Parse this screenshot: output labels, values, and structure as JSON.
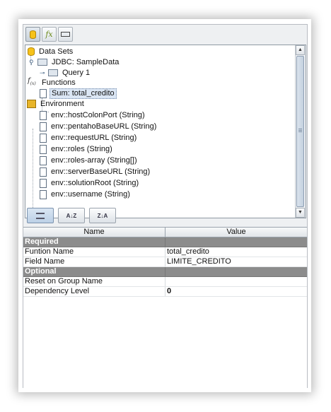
{
  "toolbar": {
    "buttons": [
      {
        "icon": "database-icon"
      },
      {
        "icon": "function-fx-icon"
      },
      {
        "icon": "environment-icon"
      }
    ]
  },
  "tree": {
    "data_sets_label": "Data Sets",
    "jdbc_label": "JDBC: SampleData",
    "query_label": "Query 1",
    "functions_label": "Functions",
    "function_item_label": "Sum: total_credito",
    "environment_label": "Environment",
    "env_items": [
      "env::hostColonPort (String)",
      "env::pentahoBaseURL (String)",
      "env::requestURL (String)",
      "env::roles (String)",
      "env::roles-array (String[])",
      "env::serverBaseURL (String)",
      "env::solutionRoot (String)",
      "env::username (String)"
    ]
  },
  "property_toolbar": {
    "buttons": [
      {
        "icon": "categorized-view-icon",
        "active": true
      },
      {
        "icon": "sort-ascending-icon",
        "label": "A↓Z"
      },
      {
        "icon": "sort-descending-icon",
        "label": "Z↓A"
      }
    ]
  },
  "properties": {
    "header_name": "Name",
    "header_value": "Value",
    "required_group": "Required",
    "rows_required": [
      {
        "name": "Funtion Name",
        "value": "total_credito"
      },
      {
        "name": "Field Name",
        "value": "LIMITE_CREDITO"
      }
    ],
    "optional_group": "Optional",
    "rows_optional": [
      {
        "name": "Reset on Group Name",
        "value": ""
      },
      {
        "name": "Dependency Level",
        "value": "0"
      }
    ]
  }
}
